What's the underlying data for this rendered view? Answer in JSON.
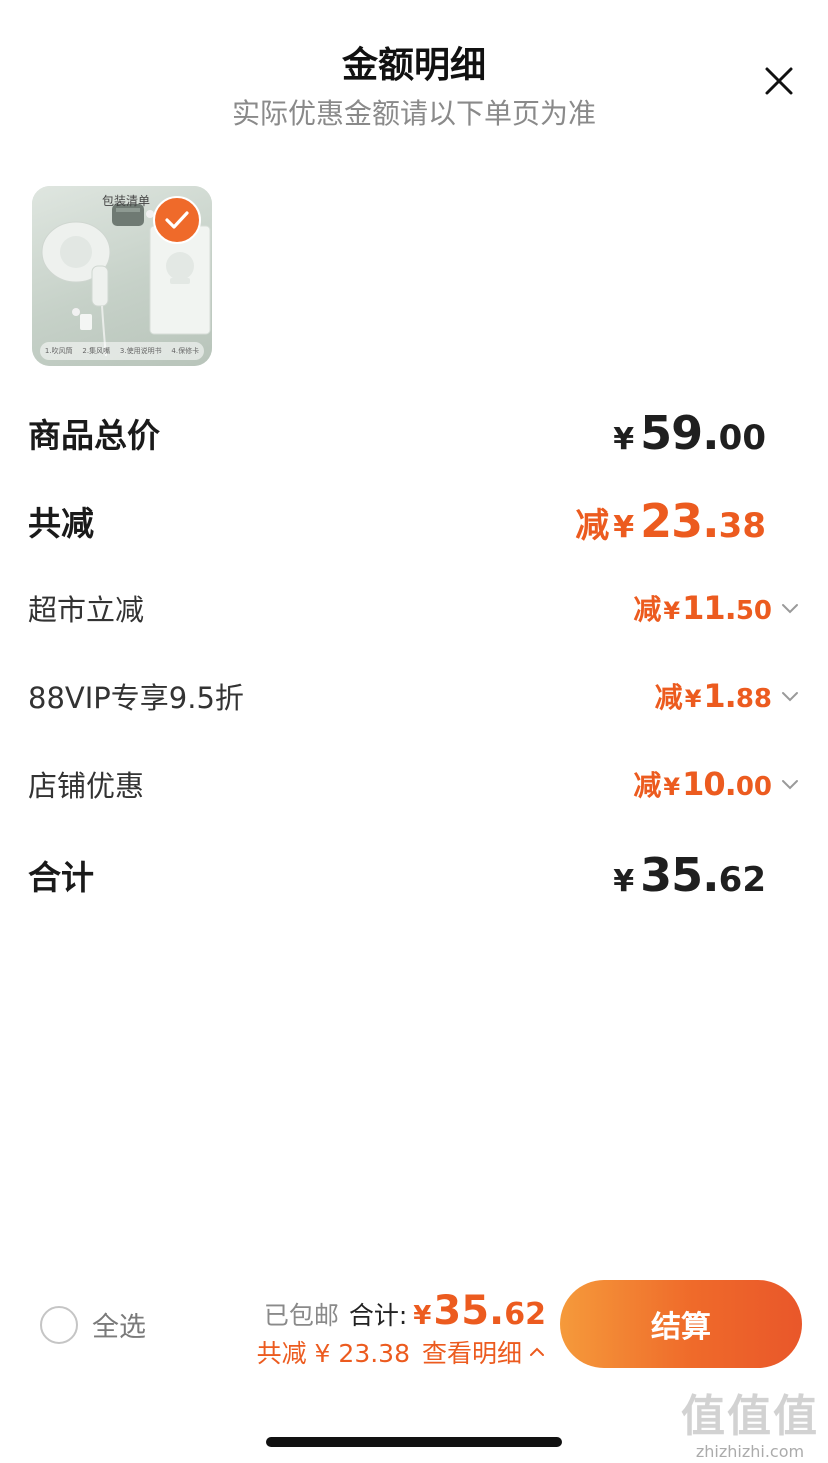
{
  "sheet": {
    "title": "金额明细",
    "subtitle": "实际优惠金额请以下单页为准",
    "close_icon": "close-icon"
  },
  "product": {
    "thumb_label": "包装清单",
    "thumb_parts": [
      "1.吹风筒",
      "2.集风嘴",
      "3.使用说明书",
      "4.保修卡"
    ],
    "selected": true
  },
  "breakdown": {
    "subtotal": {
      "label": "商品总价",
      "yen": "¥",
      "int": "59.",
      "dec": "00"
    },
    "total_discount": {
      "label": "共减",
      "prefix": "减",
      "yen": "¥",
      "int": "23.",
      "dec": "38"
    },
    "discounts": [
      {
        "label": "超市立减",
        "prefix": "减",
        "yen": "¥",
        "int": "11.",
        "dec": "50"
      },
      {
        "label": "88VIP专享9.5折",
        "prefix": "减",
        "yen": "¥",
        "int": "1.",
        "dec": "88"
      },
      {
        "label": "店铺优惠",
        "prefix": "减",
        "yen": "¥",
        "int": "10.",
        "dec": "00"
      }
    ],
    "total": {
      "label": "合计",
      "yen": "¥",
      "int": "35.",
      "dec": "62"
    }
  },
  "footer": {
    "select_all_label": "全选",
    "shipping": "已包邮",
    "total_label": "合计:",
    "total_yen": "¥",
    "total_int": "35.",
    "total_dec": "62",
    "saved_text": "共减 ¥ 23.38",
    "detail_link": "查看明细",
    "checkout_label": "结算"
  },
  "watermark": {
    "big": "值值值",
    "small": "zhizhizhi.com"
  },
  "colors": {
    "accent": "#ec5b1f",
    "checkout_start": "#f59a3b",
    "checkout_end": "#e9572a",
    "text_dark": "#1a1a1a",
    "text_muted": "#8a8a8a"
  }
}
